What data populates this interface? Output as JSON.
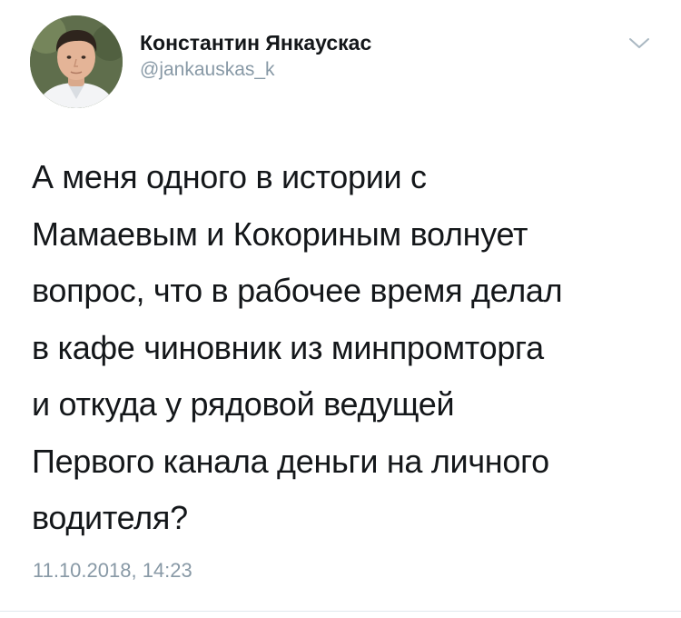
{
  "tweet": {
    "author": {
      "display_name": "Константин Янкаускас",
      "handle": "@jankauskas_k",
      "avatar_icon": "profile-photo"
    },
    "menu_icon": "chevron-down-icon",
    "text_lines": [
      "А меня одного в истории с",
      "Мамаевым и Кокориным волнует",
      "вопрос, что в рабочее время делал",
      "в кафе чиновник из минпромторга",
      "и откуда у рядовой ведущей",
      "Первого канала деньги на личного",
      "водителя?"
    ],
    "timestamp": "11.10.2018, 14:23"
  },
  "colors": {
    "text": "#14171a",
    "secondary": "#8899a6",
    "divider": "#e1e8ed"
  }
}
